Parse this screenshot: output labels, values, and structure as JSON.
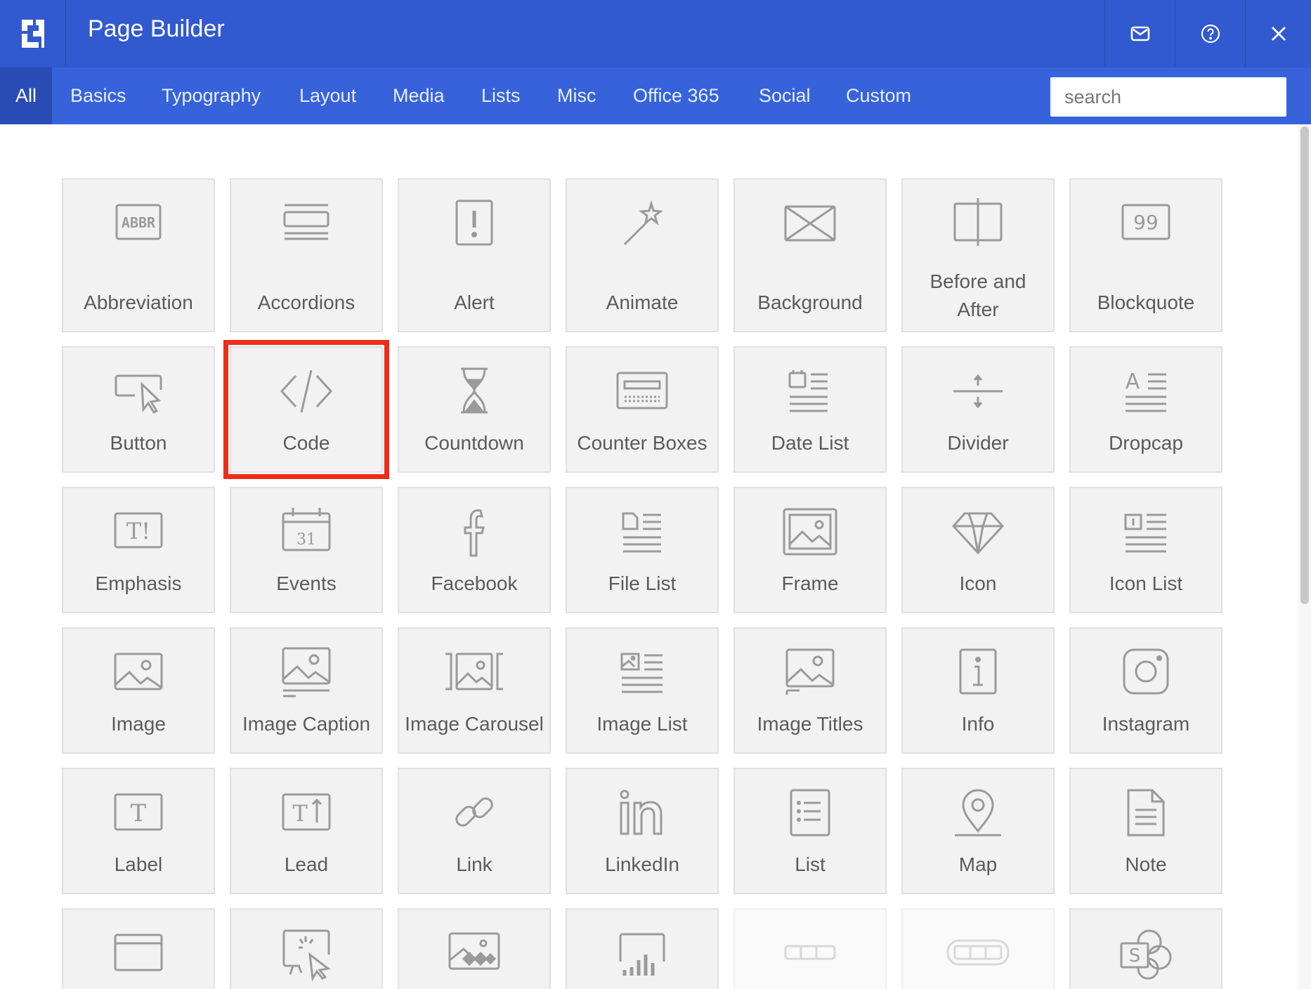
{
  "window": {
    "title": "Page Builder"
  },
  "header_buttons": {
    "mail_icon": "envelope-icon",
    "help_icon": "help-icon",
    "close_icon": "close-icon"
  },
  "tabs": [
    {
      "label": "All",
      "active": true
    },
    {
      "label": "Basics"
    },
    {
      "label": "Typography"
    },
    {
      "label": "Layout"
    },
    {
      "label": "Media"
    },
    {
      "label": "Lists"
    },
    {
      "label": "Misc"
    },
    {
      "label": "Office 365"
    },
    {
      "label": "Social"
    },
    {
      "label": "Custom"
    }
  ],
  "search": {
    "placeholder": "search",
    "value": ""
  },
  "colors": {
    "titlebar": "#3159d0",
    "tabbar": "#3663d9",
    "active_tab": "#2a4cb5",
    "highlight": "#f02b1a"
  },
  "tiles": [
    {
      "label": "Abbreviation",
      "icon": "abbr-icon"
    },
    {
      "label": "Accordions",
      "icon": "accordion-icon"
    },
    {
      "label": "Alert",
      "icon": "alert-icon"
    },
    {
      "label": "Animate",
      "icon": "magic-wand-icon"
    },
    {
      "label": "Background",
      "icon": "background-icon"
    },
    {
      "label": "Before and After",
      "icon": "before-after-icon"
    },
    {
      "label": "Blockquote",
      "icon": "quote-icon"
    },
    {
      "label": "Button",
      "icon": "button-cursor-icon"
    },
    {
      "label": "Code",
      "icon": "code-icon",
      "selected": true
    },
    {
      "label": "Countdown",
      "icon": "hourglass-icon"
    },
    {
      "label": "Counter Boxes",
      "icon": "counter-icon"
    },
    {
      "label": "Date List",
      "icon": "date-list-icon"
    },
    {
      "label": "Divider",
      "icon": "divider-icon"
    },
    {
      "label": "Dropcap",
      "icon": "dropcap-icon"
    },
    {
      "label": "Emphasis",
      "icon": "emphasis-icon"
    },
    {
      "label": "Events",
      "icon": "calendar-icon"
    },
    {
      "label": "Facebook",
      "icon": "facebook-icon"
    },
    {
      "label": "File List",
      "icon": "file-list-icon"
    },
    {
      "label": "Frame",
      "icon": "frame-icon"
    },
    {
      "label": "Icon",
      "icon": "diamond-icon"
    },
    {
      "label": "Icon List",
      "icon": "icon-list-icon"
    },
    {
      "label": "Image",
      "icon": "image-icon"
    },
    {
      "label": "Image Caption",
      "icon": "image-caption-icon"
    },
    {
      "label": "Image Carousel",
      "icon": "image-carousel-icon"
    },
    {
      "label": "Image List",
      "icon": "image-list-icon"
    },
    {
      "label": "Image Titles",
      "icon": "image-titles-icon"
    },
    {
      "label": "Info",
      "icon": "info-icon"
    },
    {
      "label": "Instagram",
      "icon": "instagram-icon"
    },
    {
      "label": "Label",
      "icon": "label-icon"
    },
    {
      "label": "Lead",
      "icon": "lead-icon"
    },
    {
      "label": "Link",
      "icon": "link-icon"
    },
    {
      "label": "LinkedIn",
      "icon": "linkedin-icon"
    },
    {
      "label": "List",
      "icon": "list-icon"
    },
    {
      "label": "Map",
      "icon": "map-pin-icon"
    },
    {
      "label": "Note",
      "icon": "note-icon"
    },
    {
      "label": "",
      "icon": "card-icon"
    },
    {
      "label": "",
      "icon": "click-icon"
    },
    {
      "label": "",
      "icon": "gallery-icon"
    },
    {
      "label": "",
      "icon": "chart-icon"
    },
    {
      "label": "",
      "icon": "progress-bar-icon",
      "faded": true
    },
    {
      "label": "",
      "icon": "progress-pill-icon",
      "faded": true
    },
    {
      "label": "",
      "icon": "sharepoint-icon"
    }
  ]
}
